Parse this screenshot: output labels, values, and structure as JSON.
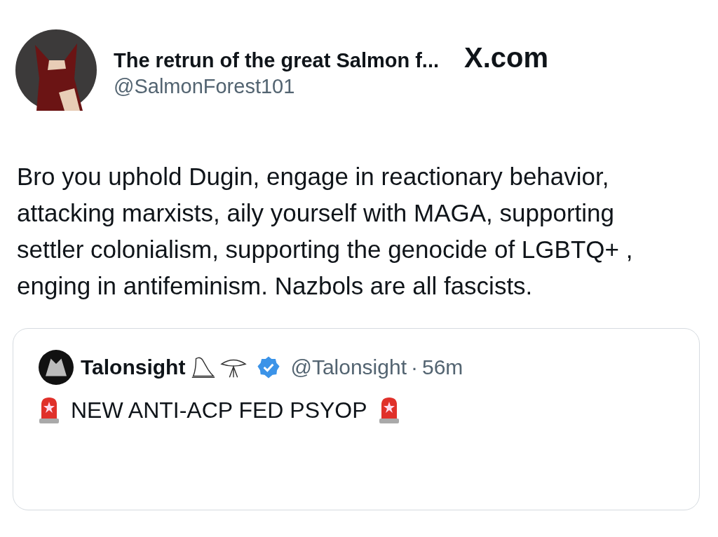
{
  "tweet": {
    "display_name": "The retrun of the great Salmon f...",
    "handle": "@SalmonForest101",
    "site": "X.com",
    "text": "Bro you uphold Dugin, engage in reactionary behavior, attacking marxists, aily yourself with MAGA, supporting settler colonialism, supporting the genocide of LGBTQ+ ,  enging in antifeminism.  Nazbols are all fascists.",
    "quoted": {
      "display_name": "Talonsight",
      "verified": true,
      "handle": "@Talonsight",
      "separator": "·",
      "time": "56m",
      "text": "NEW ANTI-ACP FED PSYOP"
    }
  }
}
